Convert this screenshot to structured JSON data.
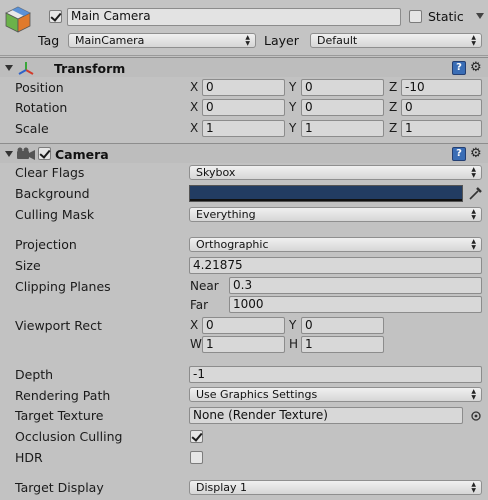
{
  "header": {
    "active": true,
    "name": "Main Camera",
    "static_label": "Static",
    "static_checked": false,
    "tag_label": "Tag",
    "tag_value": "MainCamera",
    "layer_label": "Layer",
    "layer_value": "Default"
  },
  "transform": {
    "title": "Transform",
    "help": "?",
    "rows": [
      {
        "label": "Position",
        "x": "0",
        "y": "0",
        "z": "-10"
      },
      {
        "label": "Rotation",
        "x": "0",
        "y": "0",
        "z": "0"
      },
      {
        "label": "Scale",
        "x": "1",
        "y": "1",
        "z": "1"
      }
    ],
    "axis_x": "X",
    "axis_y": "Y",
    "axis_z": "Z"
  },
  "camera": {
    "title": "Camera",
    "enabled": true,
    "help": "?",
    "clear_flags_label": "Clear Flags",
    "clear_flags_value": "Skybox",
    "background_label": "Background",
    "background_color": "#223c62",
    "culling_mask_label": "Culling Mask",
    "culling_mask_value": "Everything",
    "projection_label": "Projection",
    "projection_value": "Orthographic",
    "size_label": "Size",
    "size_value": "4.21875",
    "clipping_label": "Clipping Planes",
    "near_label": "Near",
    "near_value": "0.3",
    "far_label": "Far",
    "far_value": "1000",
    "viewport_label": "Viewport Rect",
    "vp_x_label": "X",
    "vp_x": "0",
    "vp_y_label": "Y",
    "vp_y": "0",
    "vp_w_label": "W",
    "vp_w": "1",
    "vp_h_label": "H",
    "vp_h": "1",
    "depth_label": "Depth",
    "depth_value": "-1",
    "rendering_path_label": "Rendering Path",
    "rendering_path_value": "Use Graphics Settings",
    "target_texture_label": "Target Texture",
    "target_texture_value": "None (Render Texture)",
    "occlusion_label": "Occlusion Culling",
    "occlusion_checked": true,
    "hdr_label": "HDR",
    "hdr_checked": false,
    "target_display_label": "Target Display",
    "target_display_value": "Display 1"
  },
  "colors": {
    "accent_blue": "#3a6db5",
    "panel_bg": "#c2c2c2"
  }
}
